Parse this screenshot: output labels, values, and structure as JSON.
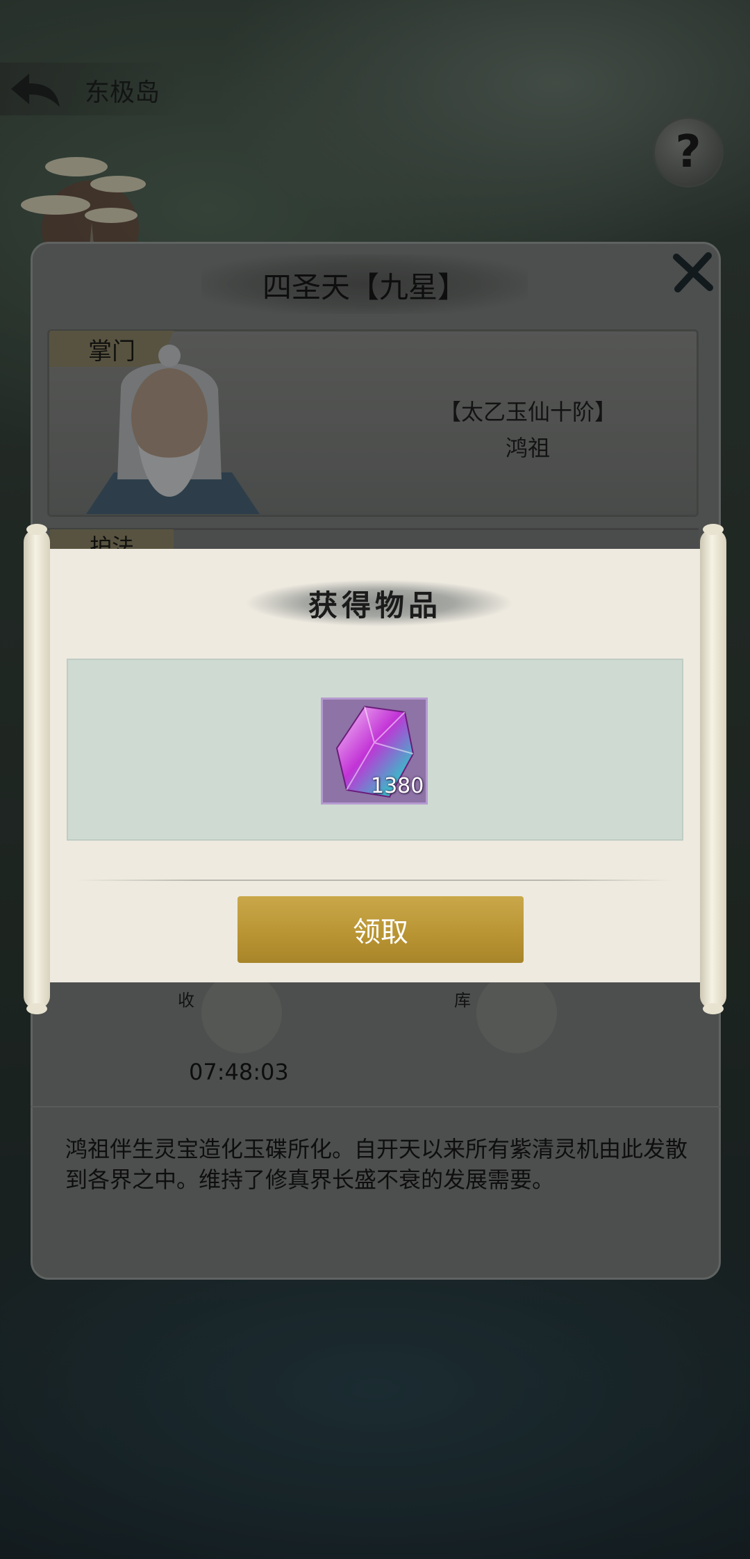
{
  "header": {
    "location": "东极岛"
  },
  "panel": {
    "title": "四圣天【九星】",
    "master": {
      "tag": "掌门",
      "rank": "【太乙玉仙十阶】",
      "name": "鸿祖"
    },
    "guard": {
      "tag": "护法"
    },
    "skills": [
      {
        "label": "收"
      },
      {
        "label": "库"
      }
    ],
    "timer": "07:48:03",
    "description": "鸿祖伴生灵宝造化玉碟所化。自开天以来所有紫清灵机由此发散到各界之中。维持了修真界长盛不衰的发展需要。"
  },
  "reward_modal": {
    "title": "获得物品",
    "item": {
      "icon": "purple-crystal-icon",
      "count": "1380"
    },
    "claim_label": "领取"
  },
  "colors": {
    "claim_button": "#b89332",
    "item_bg": "#8e73a6"
  }
}
